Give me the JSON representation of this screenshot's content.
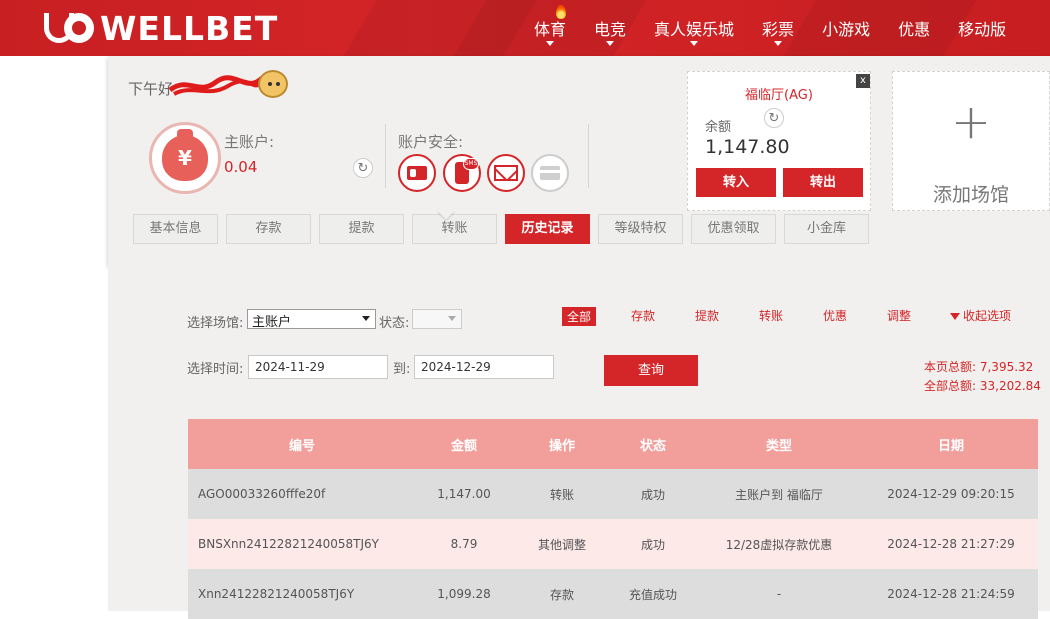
{
  "brand": {
    "logo_text": "WELLBET",
    "primary": "#d42528",
    "accent_light": "#f29f9c"
  },
  "nav": {
    "items": [
      {
        "label": "体育",
        "caret": true,
        "hot": true
      },
      {
        "label": "电竞",
        "caret": true
      },
      {
        "label": "真人娱乐城",
        "caret": true
      },
      {
        "label": "彩票",
        "caret": true
      },
      {
        "label": "小游戏",
        "caret": false
      },
      {
        "label": "优惠",
        "caret": false
      },
      {
        "label": "移动版",
        "caret": false
      }
    ]
  },
  "account": {
    "greeting": "下午好",
    "main_account_label": "主账户:",
    "main_account_value": "0.04",
    "wallet_symbol": "¥",
    "security_label": "账户安全:",
    "security_icons": [
      "id-card-icon",
      "sms-phone-icon",
      "email-icon",
      "bank-card-icon"
    ],
    "sms_badge": "SMS"
  },
  "venue_card": {
    "name": "福临厅(AG)",
    "balance_label": "余额",
    "balance_value": "1,147.80",
    "transfer_in": "转入",
    "transfer_out": "转出",
    "close": "x"
  },
  "add_venue": {
    "plus": "+",
    "label": "添加场馆"
  },
  "tabs": [
    {
      "label": "基本信息",
      "active": false
    },
    {
      "label": "存款",
      "active": false
    },
    {
      "label": "提款",
      "active": false
    },
    {
      "label": "转账",
      "active": false
    },
    {
      "label": "历史记录",
      "active": true
    },
    {
      "label": "等级特权",
      "active": false
    },
    {
      "label": "优惠领取",
      "active": false
    },
    {
      "label": "小金库",
      "active": false
    }
  ],
  "filters": {
    "venue_label": "选择场馆:",
    "venue_value": "主账户",
    "status_label": "状态:",
    "status_value": "",
    "time_label": "选择时间:",
    "date_from": "2024-11-29",
    "to_label": "到:",
    "date_to": "2024-12-29",
    "query_button": "查询",
    "types": [
      {
        "label": "全部",
        "active": true
      },
      {
        "label": "存款",
        "active": false
      },
      {
        "label": "提款",
        "active": false
      },
      {
        "label": "转账",
        "active": false
      },
      {
        "label": "优惠",
        "active": false
      },
      {
        "label": "调整",
        "active": false
      }
    ],
    "collapse_label": "收起选项"
  },
  "totals": {
    "page_total": "本页总额: 7,395.32",
    "all_total": "全部总额: 33,202.84"
  },
  "table": {
    "headers": [
      "编号",
      "金额",
      "操作",
      "状态",
      "类型",
      "日期"
    ],
    "rows": [
      [
        "AGO00033260fffe20f",
        "1,147.00",
        "转账",
        "成功",
        "主账户到 福临厅",
        "2024-12-29 09:20:15"
      ],
      [
        "BNSXnn24122821240058TJ6Y",
        "8.79",
        "其他调整",
        "成功",
        "12/28虚拟存款优惠",
        "2024-12-28 21:27:29"
      ],
      [
        "Xnn24122821240058TJ6Y",
        "1,099.28",
        "存款",
        "充值成功",
        "-",
        "2024-12-28 21:24:59"
      ]
    ],
    "row_colors": [
      "#dddddd",
      "#fce9e8",
      "#dddddd"
    ]
  }
}
